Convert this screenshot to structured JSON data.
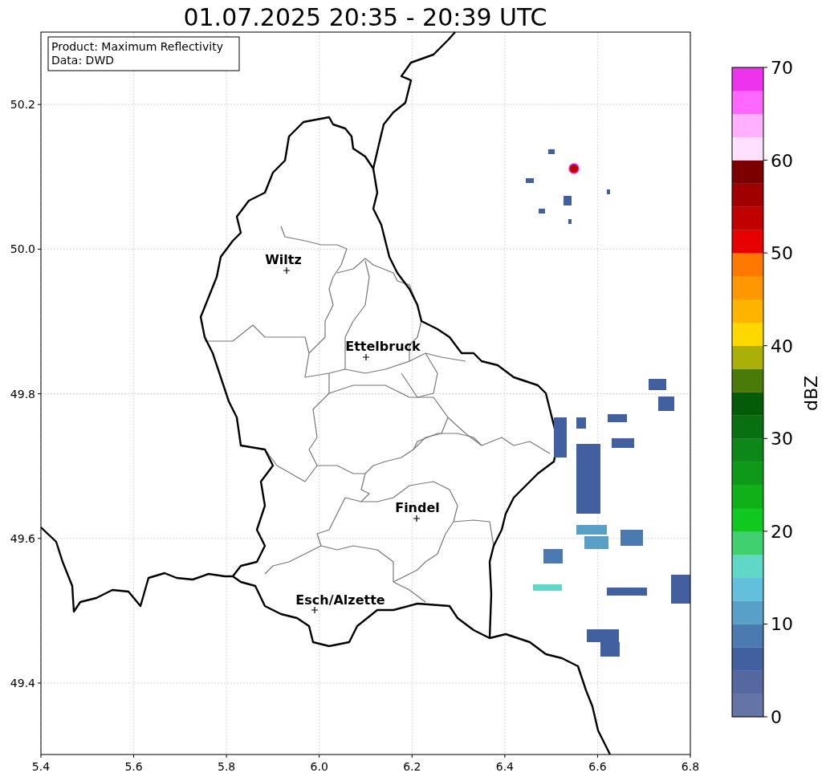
{
  "title": "01.07.2025 20:35 - 20:39 UTC",
  "info_box": [
    "Product: Maximum Reflectivity",
    "Data: DWD"
  ],
  "cities": [
    "Wiltz",
    "Ettelbruck",
    "Findel",
    "Esch/Alzette"
  ],
  "x_axis": {
    "ticks": [
      "5.4",
      "5.6",
      "5.8",
      "6.0",
      "6.2",
      "6.4",
      "6.6",
      "6.8"
    ]
  },
  "y_axis": {
    "ticks": [
      "50.2",
      "50.0",
      "49.8",
      "49.6",
      "49.4"
    ]
  },
  "colorbar": {
    "label": "dBZ",
    "ticks": [
      "70",
      "60",
      "50",
      "40",
      "30",
      "20",
      "10",
      "0"
    ],
    "bins": [
      {
        "color": "#6474a6"
      },
      {
        "color": "#5668a0"
      },
      {
        "color": "#425fa0"
      },
      {
        "color": "#4a7ab0"
      },
      {
        "color": "#58a0c8"
      },
      {
        "color": "#62c0dc"
      },
      {
        "color": "#60d8c8"
      },
      {
        "color": "#40d070"
      },
      {
        "color": "#10c820"
      },
      {
        "color": "#10b018"
      },
      {
        "color": "#0e9a18"
      },
      {
        "color": "#0c8818"
      },
      {
        "color": "#087010"
      },
      {
        "color": "#045c08"
      },
      {
        "color": "#4a7a08"
      },
      {
        "color": "#aab008"
      },
      {
        "color": "#ffd800"
      },
      {
        "color": "#ffb400"
      },
      {
        "color": "#ff9800"
      },
      {
        "color": "#ff7800"
      },
      {
        "color": "#e80000"
      },
      {
        "color": "#c00000"
      },
      {
        "color": "#a00000"
      },
      {
        "color": "#7c0000"
      },
      {
        "color": "#ffe0ff"
      },
      {
        "color": "#ffb0ff"
      },
      {
        "color": "#ff68ff"
      },
      {
        "color": "#ee33ee"
      }
    ]
  }
}
